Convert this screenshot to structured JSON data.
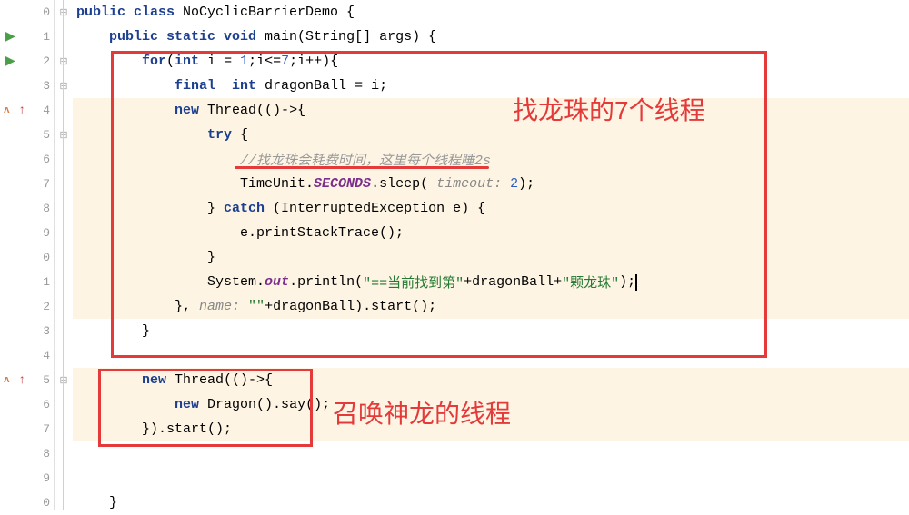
{
  "lines": {
    "l0": "public class NoCyclicBarrierDemo {",
    "l1": "    public static void main(String[] args) {",
    "l2": "        for(int i = 1;i<=7;i++){",
    "l3": "            final  int dragonBall = i;",
    "l4": "            new Thread(()->{",
    "l5": "                try {",
    "l6_comment": "                    //找龙珠会耗费时间，这里每个线程睡2s",
    "l7_a": "                    TimeUnit.",
    "l7_b": "SECONDS",
    "l7_c": ".sleep( ",
    "l7_param": "timeout: ",
    "l7_d": "2);",
    "l8": "                } catch (InterruptedException e) {",
    "l9": "                    e.printStackTrace();",
    "l10": "                }",
    "l11_a": "                System.",
    "l11_b": "out",
    "l11_c": ".println(",
    "l11_str1": "\"==当前找到第\"",
    "l11_plus1": "+dragonBall+",
    "l11_str2": "\"颗龙珠\"",
    "l11_d": ");",
    "l12_a": "            }, ",
    "l12_param": "name: ",
    "l12_str": "\"\"",
    "l12_b": "+dragonBall).start();",
    "l13": "        }",
    "l14": "",
    "l15": "        new Thread(()->{",
    "l16": "            new Dragon().say();",
    "l17": "        }).start();",
    "l18": "",
    "l19": "",
    "l20": "    }"
  },
  "annotations": {
    "a1": "找龙珠的7个线程",
    "a2": "召唤神龙的线程"
  },
  "line_numbers": [
    "0",
    "1",
    "2",
    "3",
    "4",
    "5",
    "6",
    "7",
    "8",
    "9",
    "0",
    "1",
    "2",
    "3",
    "4",
    "5",
    "6",
    "7",
    "8",
    "9",
    "0"
  ]
}
